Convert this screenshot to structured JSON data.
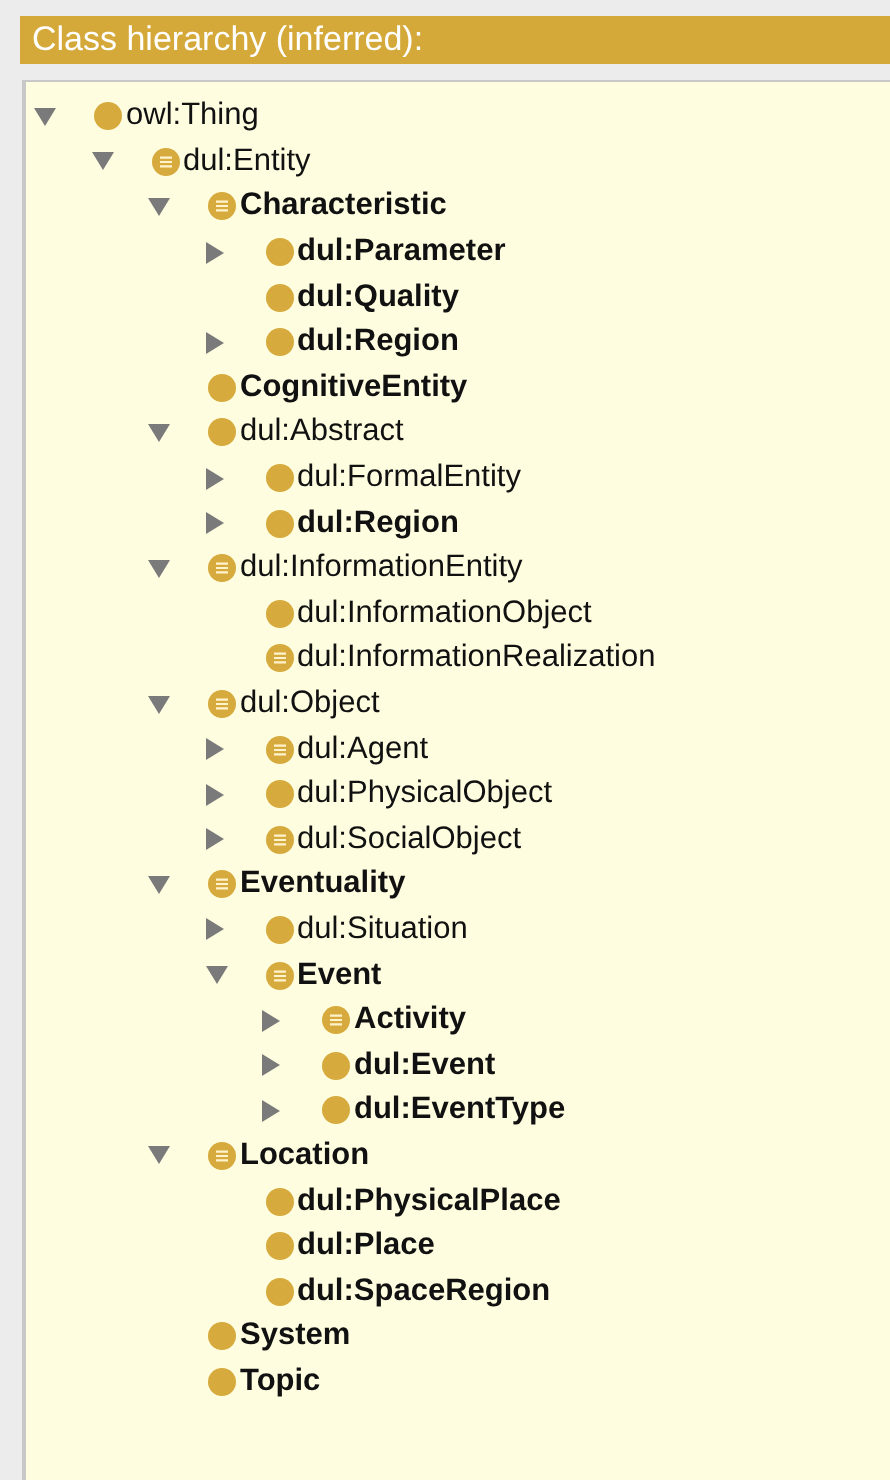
{
  "panel": {
    "title": "Class hierarchy (inferred):"
  },
  "tree": [
    {
      "label": "owl:Thing",
      "bold": false,
      "kind": "primitive",
      "expandable": true,
      "expanded": true,
      "children": [
        {
          "label": "dul:Entity",
          "bold": false,
          "kind": "defined",
          "expandable": true,
          "expanded": true,
          "children": [
            {
              "label": "Characteristic",
              "bold": true,
              "kind": "defined",
              "expandable": true,
              "expanded": true,
              "children": [
                {
                  "label": "dul:Parameter",
                  "bold": true,
                  "kind": "primitive",
                  "expandable": true,
                  "expanded": false
                },
                {
                  "label": "dul:Quality",
                  "bold": true,
                  "kind": "primitive",
                  "expandable": false
                },
                {
                  "label": "dul:Region",
                  "bold": true,
                  "kind": "primitive",
                  "expandable": true,
                  "expanded": false
                }
              ]
            },
            {
              "label": "CognitiveEntity",
              "bold": true,
              "kind": "primitive",
              "expandable": false
            },
            {
              "label": "dul:Abstract",
              "bold": false,
              "kind": "primitive",
              "expandable": true,
              "expanded": true,
              "children": [
                {
                  "label": "dul:FormalEntity",
                  "bold": false,
                  "kind": "primitive",
                  "expandable": true,
                  "expanded": false
                },
                {
                  "label": "dul:Region",
                  "bold": true,
                  "kind": "primitive",
                  "expandable": true,
                  "expanded": false
                }
              ]
            },
            {
              "label": "dul:InformationEntity",
              "bold": false,
              "kind": "defined",
              "expandable": true,
              "expanded": true,
              "children": [
                {
                  "label": "dul:InformationObject",
                  "bold": false,
                  "kind": "primitive",
                  "expandable": false
                },
                {
                  "label": "dul:InformationRealization",
                  "bold": false,
                  "kind": "defined",
                  "expandable": false
                }
              ]
            },
            {
              "label": "dul:Object",
              "bold": false,
              "kind": "defined",
              "expandable": true,
              "expanded": true,
              "children": [
                {
                  "label": "dul:Agent",
                  "bold": false,
                  "kind": "defined",
                  "expandable": true,
                  "expanded": false
                },
                {
                  "label": "dul:PhysicalObject",
                  "bold": false,
                  "kind": "primitive",
                  "expandable": true,
                  "expanded": false
                },
                {
                  "label": "dul:SocialObject",
                  "bold": false,
                  "kind": "defined",
                  "expandable": true,
                  "expanded": false
                }
              ]
            },
            {
              "label": "Eventuality",
              "bold": true,
              "kind": "defined",
              "expandable": true,
              "expanded": true,
              "children": [
                {
                  "label": "dul:Situation",
                  "bold": false,
                  "kind": "primitive",
                  "expandable": true,
                  "expanded": false
                },
                {
                  "label": "Event",
                  "bold": true,
                  "kind": "defined",
                  "expandable": true,
                  "expanded": true,
                  "children": [
                    {
                      "label": "Activity",
                      "bold": true,
                      "kind": "defined",
                      "expandable": true,
                      "expanded": false
                    },
                    {
                      "label": "dul:Event",
                      "bold": true,
                      "kind": "primitive",
                      "expandable": true,
                      "expanded": false
                    },
                    {
                      "label": "dul:EventType",
                      "bold": true,
                      "kind": "primitive",
                      "expandable": true,
                      "expanded": false
                    }
                  ]
                }
              ]
            },
            {
              "label": "Location",
              "bold": true,
              "kind": "defined",
              "expandable": true,
              "expanded": true,
              "children": [
                {
                  "label": "dul:PhysicalPlace",
                  "bold": true,
                  "kind": "primitive",
                  "expandable": false
                },
                {
                  "label": "dul:Place",
                  "bold": true,
                  "kind": "primitive",
                  "expandable": false
                },
                {
                  "label": "dul:SpaceRegion",
                  "bold": true,
                  "kind": "primitive",
                  "expandable": false
                }
              ]
            },
            {
              "label": "System",
              "bold": true,
              "kind": "primitive",
              "expandable": false
            },
            {
              "label": "Topic",
              "bold": true,
              "kind": "primitive",
              "expandable": false
            }
          ]
        }
      ]
    }
  ]
}
